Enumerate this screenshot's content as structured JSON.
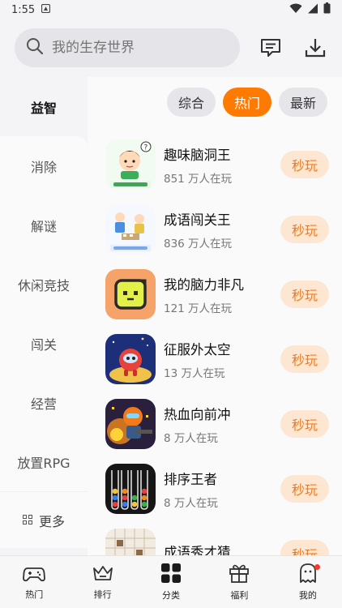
{
  "status": {
    "time": "1:55"
  },
  "search": {
    "placeholder": "我的生存世界"
  },
  "sidebar": {
    "active": "益智",
    "items": [
      "消除",
      "解谜",
      "休闲竞技",
      "闯关",
      "经营",
      "放置RPG"
    ],
    "more_label": "更多"
  },
  "filters": [
    {
      "label": "综合",
      "active": false
    },
    {
      "label": "热门",
      "active": true
    },
    {
      "label": "最新",
      "active": false
    }
  ],
  "games": [
    {
      "name": "趣味脑洞王",
      "players": "851 万人在玩",
      "action": "秒玩",
      "icon": "cartoon-kid-icon"
    },
    {
      "name": "成语闯关王",
      "players": "836 万人在玩",
      "action": "秒玩",
      "icon": "chess-kids-icon"
    },
    {
      "name": "我的脑力非凡",
      "players": "121 万人在玩",
      "action": "秒玩",
      "icon": "tv-face-icon"
    },
    {
      "name": "征服外太空",
      "players": "13 万人在玩",
      "action": "秒玩",
      "icon": "space-monster-icon"
    },
    {
      "name": "热血向前冲",
      "players": "8 万人在玩",
      "action": "秒玩",
      "icon": "soldier-icon"
    },
    {
      "name": "排序王者",
      "players": "8 万人在玩",
      "action": "秒玩",
      "icon": "ball-sort-icon"
    },
    {
      "name": "成语秀才猜",
      "players": "",
      "action": "秒玩",
      "icon": "idiom-grid-icon"
    }
  ],
  "tabs": [
    {
      "label": "热门",
      "icon": "gamepad-icon"
    },
    {
      "label": "排行",
      "icon": "crown-icon"
    },
    {
      "label": "分类",
      "icon": "grid-icon"
    },
    {
      "label": "福利",
      "icon": "gift-icon"
    },
    {
      "label": "我的",
      "icon": "ghost-icon"
    }
  ],
  "colors": {
    "accent": "#ff7a00",
    "play_bg": "#fde6d2",
    "play_text": "#f47a1a"
  }
}
